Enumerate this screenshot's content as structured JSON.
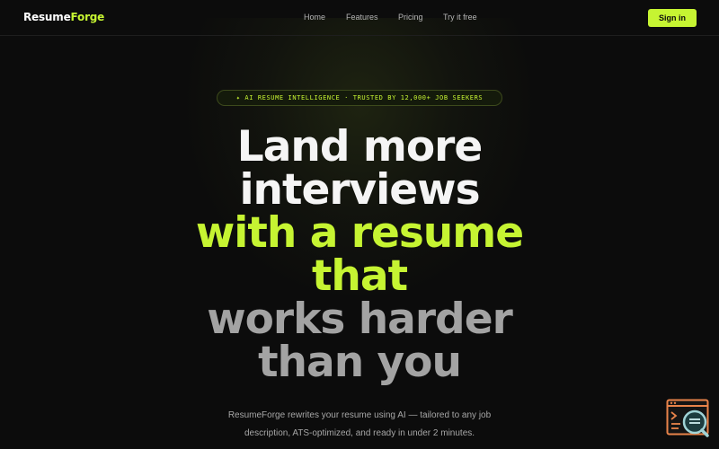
{
  "brand": {
    "name_part1": "Resume",
    "name_part2": "Forge",
    "accent_color": "#c6f432"
  },
  "nav": {
    "links": [
      {
        "label": "Home"
      },
      {
        "label": "Features"
      },
      {
        "label": "Pricing"
      },
      {
        "label": "Try it free"
      }
    ],
    "signin_label": "Sign in"
  },
  "hero": {
    "badge": "✦ AI RESUME INTELLIGENCE · TRUSTED BY 12,000+ JOB SEEKERS",
    "headline_lines": [
      "Land more",
      "interviews",
      "with a resume",
      "that",
      "works harder",
      "than you"
    ],
    "subtext_line1": "ResumeForge rewrites your resume using AI — tailored to any job",
    "subtext_line2": "description, ATS-optimized, and ready in under 2 minutes."
  },
  "widget": {
    "icon": "terminal-search-icon",
    "border_color": "#e8834a"
  }
}
